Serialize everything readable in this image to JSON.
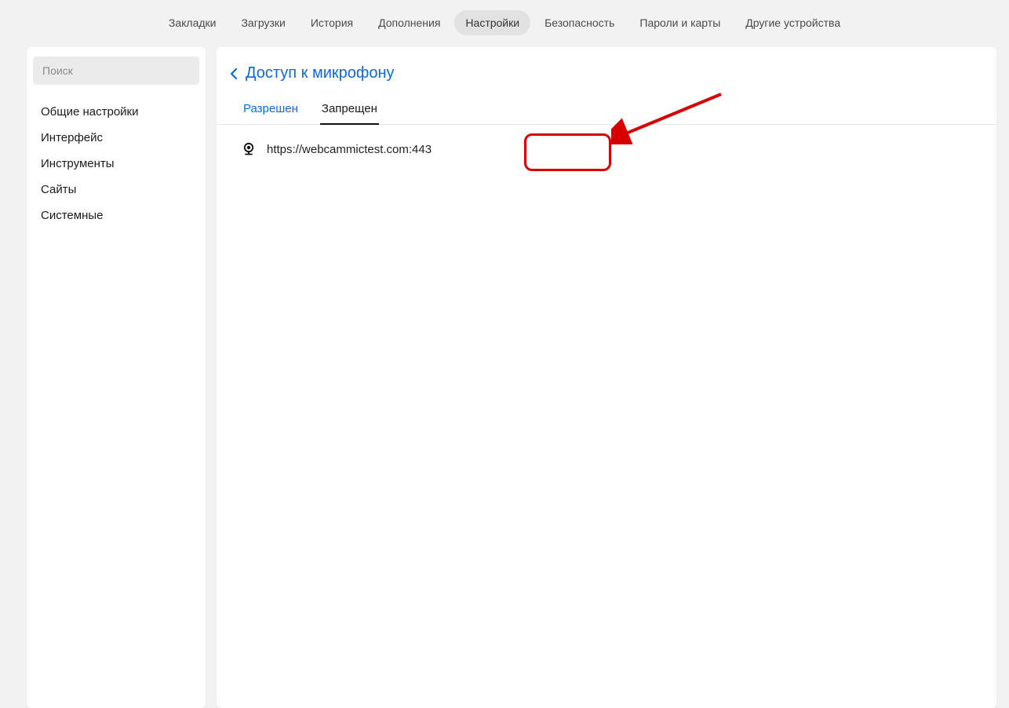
{
  "topnav": {
    "items": [
      "Закладки",
      "Загрузки",
      "История",
      "Дополнения",
      "Настройки",
      "Безопасность",
      "Пароли и карты",
      "Другие устройства"
    ],
    "activeIndex": 4
  },
  "sidebar": {
    "searchPlaceholder": "Поиск",
    "items": [
      "Общие настройки",
      "Интерфейс",
      "Инструменты",
      "Сайты",
      "Системные"
    ]
  },
  "main": {
    "title": "Доступ к микрофону",
    "tabs": {
      "allowed": "Разрешен",
      "denied": "Запрещен"
    },
    "sites": [
      {
        "url": "https://webcammictest.com:443"
      }
    ]
  },
  "annotation": {
    "highlightColor": "#d60000"
  }
}
